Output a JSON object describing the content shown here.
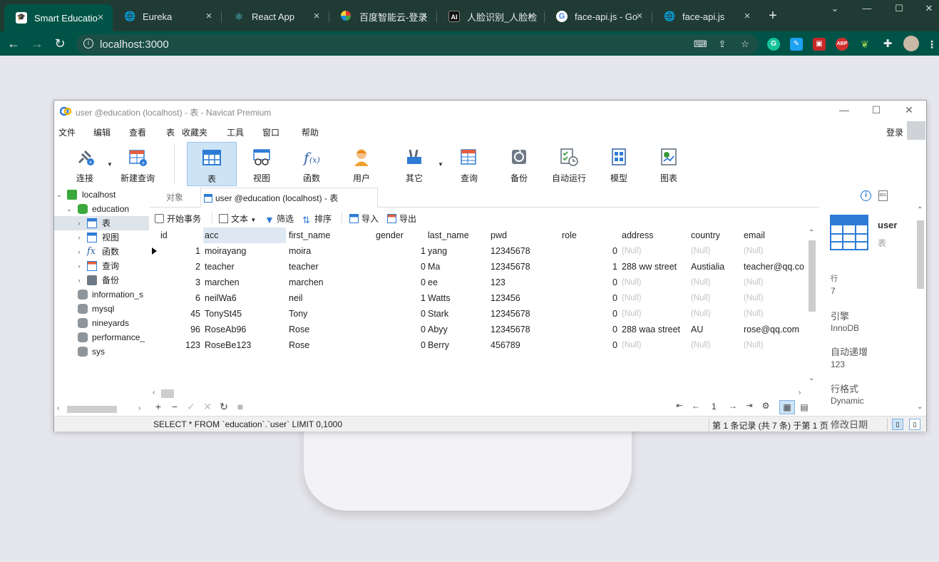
{
  "browser": {
    "tabs": [
      {
        "title": "Smart Educatio",
        "icon": "graduation-icon",
        "active": true
      },
      {
        "title": "Eureka",
        "icon": "globe-icon",
        "active": false
      },
      {
        "title": "React App",
        "icon": "react-icon",
        "active": false
      },
      {
        "title": "百度智能云-登录",
        "icon": "baidu-cloud-icon",
        "active": false
      },
      {
        "title": "人脸识别_人脸检",
        "icon": "ai-icon",
        "active": false
      },
      {
        "title": "face-api.js - Go",
        "icon": "google-icon",
        "active": false
      },
      {
        "title": "face-api.js",
        "icon": "globe-icon",
        "active": false
      }
    ],
    "url": "localhost:3000",
    "colors": {
      "frame": "#1f3b33",
      "toolbar": "#005447"
    }
  },
  "navicat": {
    "window_title": "user @education (localhost) - 表 - Navicat Premium",
    "menu": [
      "文件",
      "编辑",
      "查看",
      "表",
      "收藏夹",
      "工具",
      "窗口",
      "帮助"
    ],
    "login": "登录",
    "toolbar": [
      {
        "label": "连接",
        "icon": "connection-icon"
      },
      {
        "label": "新建查询",
        "icon": "new-query-icon"
      },
      {
        "label": "表",
        "icon": "table-icon"
      },
      {
        "label": "视图",
        "icon": "view-icon"
      },
      {
        "label": "函数",
        "icon": "function-icon"
      },
      {
        "label": "用户",
        "icon": "user-icon"
      },
      {
        "label": "其它",
        "icon": "tools-icon"
      },
      {
        "label": "查询",
        "icon": "query-icon"
      },
      {
        "label": "备份",
        "icon": "backup-icon"
      },
      {
        "label": "自动运行",
        "icon": "schedule-icon"
      },
      {
        "label": "模型",
        "icon": "model-icon"
      },
      {
        "label": "图表",
        "icon": "chart-icon"
      }
    ],
    "tree": {
      "connection": "localhost",
      "database": "education",
      "db_children": [
        "表",
        "视图",
        "函数",
        "查询",
        "备份"
      ],
      "other_databases": [
        "information_s",
        "mysql",
        "nineyards",
        "performance_",
        "sys"
      ]
    },
    "tabs": {
      "objects": "对象",
      "open_tab": "user @education (localhost) - 表"
    },
    "subtoolbar": {
      "begin_tx": "开始事务",
      "text": "文本",
      "filter": "筛选",
      "sort": "排序",
      "import": "导入",
      "export": "导出"
    },
    "grid": {
      "columns": [
        "id",
        "acc",
        "first_name",
        "gender",
        "last_name",
        "pwd",
        "role",
        "address",
        "country",
        "email"
      ],
      "rows": [
        [
          "1",
          "moirayang",
          "moira",
          "1",
          "yang",
          "12345678",
          "0",
          "(Null)",
          "(Null)",
          "(Null)"
        ],
        [
          "2",
          "teacher",
          "teacher",
          "0",
          "Ma",
          "12345678",
          "1",
          "288 ww street",
          "Austialia",
          "teacher@qq.co"
        ],
        [
          "3",
          "marchen",
          "marchen",
          "0",
          "ee",
          "123",
          "0",
          "(Null)",
          "(Null)",
          "(Null)"
        ],
        [
          "6",
          "neilWa6",
          "neil",
          "1",
          "Watts",
          "123456",
          "0",
          "(Null)",
          "(Null)",
          "(Null)"
        ],
        [
          "45",
          "TonySt45",
          "Tony",
          "0",
          "Stark",
          "12345678",
          "0",
          "(Null)",
          "(Null)",
          "(Null)"
        ],
        [
          "96",
          "RoseAb96",
          "Rose",
          "0",
          "Abyy",
          "12345678",
          "0",
          "288 waa street",
          "AU",
          "rose@qq.com"
        ],
        [
          "123",
          "RoseBe123",
          "Rose",
          "0",
          "Berry",
          "456789",
          "0",
          "(Null)",
          "(Null)",
          "(Null)"
        ]
      ]
    },
    "pager": {
      "page": "1"
    },
    "status": {
      "sql": "SELECT * FROM `education`.`user` LIMIT 0,1000",
      "records": "第 1 条记录 (共 7 条) 于第 1 页"
    },
    "info": {
      "table_name": "user",
      "table_type": "表",
      "props": [
        {
          "label": "行",
          "value": "7"
        },
        {
          "label": "引擎",
          "value": "InnoDB"
        },
        {
          "label": "自动递增",
          "value": "123"
        },
        {
          "label": "行格式",
          "value": "Dynamic"
        },
        {
          "label": "修改日期",
          "value": ""
        }
      ]
    }
  }
}
